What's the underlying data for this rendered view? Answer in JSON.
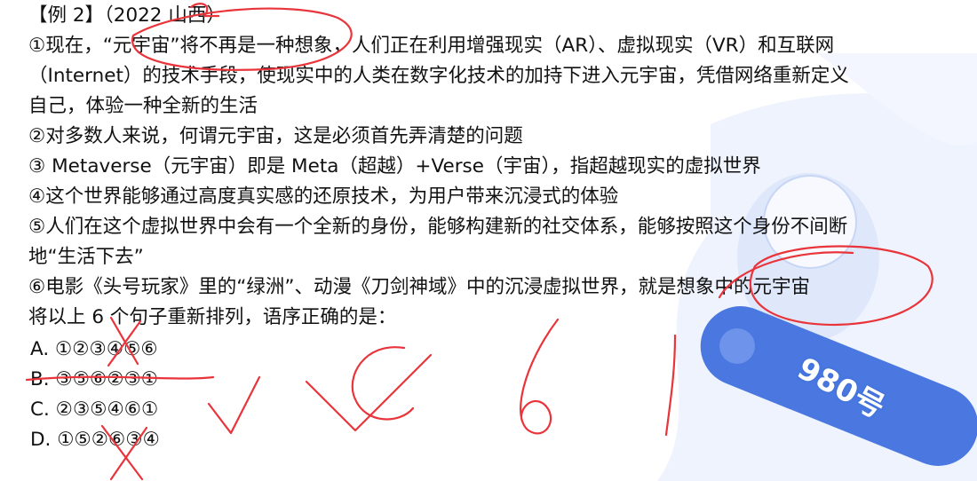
{
  "colors": {
    "ink": "#e8343a",
    "text": "#111111",
    "decor_blue": "#4a78e0",
    "decor_light": "#dfe8fb"
  },
  "heading": "【例 2】（2022 山西）",
  "sentences": [
    "①现在，“元宇宙”将不再是一种想象，人们正在利用增强现实（AR）、虚拟现实（VR）和互联网",
    "（Internet）的技术手段，使现实中的人类在数字化技术的加持下进入元宇宙，凭借网络重新定义",
    "自己，体验一种全新的生活",
    "②对多数人来说，何谓元宇宙，这是必须首先弄清楚的问题",
    "③ Metaverse（元宇宙）即是 Meta（超越）+Verse（宇宙），指超越现实的虚拟世界",
    "④这个世界能够通过高度真实感的还原技术，为用户带来沉浸式的体验",
    "⑤人们在这个虚拟世界中会有一个全新的身份，能够构建新的社交体系，能够按照这个身份不间断",
    "地“生活下去”",
    "⑥电影《头号玩家》里的“绿洲”、动漫《刀剑神域》中的沉浸虚拟世界，就是想象中的元宇宙"
  ],
  "question": "将以上 6 个句子重新排列，语序正确的是：",
  "options": [
    "A. ①②③④⑤⑥",
    "B. ③⑤⑥②③①",
    "C. ②③⑤④⑥①",
    "D. ①⑤②⑥③④"
  ],
  "watermark": {
    "brand": "980号"
  }
}
